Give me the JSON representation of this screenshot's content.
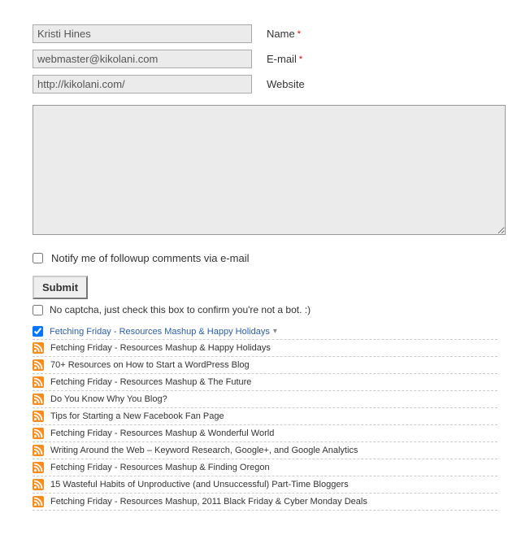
{
  "form": {
    "name": {
      "value": "Kristi Hines",
      "label": "Name",
      "required": "*"
    },
    "email": {
      "value": "webmaster@kikolani.com",
      "label": "E-mail",
      "required": "*"
    },
    "website": {
      "value": "http://kikolani.com/",
      "label": "Website"
    },
    "comment": {
      "value": ""
    },
    "notify_label": "Notify me of followup comments via e-mail",
    "submit_label": "Submit",
    "captcha_label": "No captcha, just check this box to confirm you're not a bot. :)"
  },
  "posts": [
    {
      "title": "Fetching Friday - Resources Mashup & Happy Holidays",
      "selected": true
    },
    {
      "title": "Fetching Friday - Resources Mashup & Happy Holidays"
    },
    {
      "title": "70+ Resources on How to Start a WordPress Blog"
    },
    {
      "title": "Fetching Friday - Resources Mashup & The Future"
    },
    {
      "title": "Do You Know Why You Blog?"
    },
    {
      "title": "Tips for Starting a New Facebook Fan Page"
    },
    {
      "title": "Fetching Friday - Resources Mashup & Wonderful World"
    },
    {
      "title": "Writing Around the Web – Keyword Research, Google+, and Google Analytics"
    },
    {
      "title": "Fetching Friday - Resources Mashup & Finding Oregon"
    },
    {
      "title": "15 Wasteful Habits of Unproductive (and Unsuccessful) Part-Time Bloggers"
    },
    {
      "title": "Fetching Friday - Resources Mashup, 2011 Black Friday & Cyber Monday Deals"
    }
  ]
}
